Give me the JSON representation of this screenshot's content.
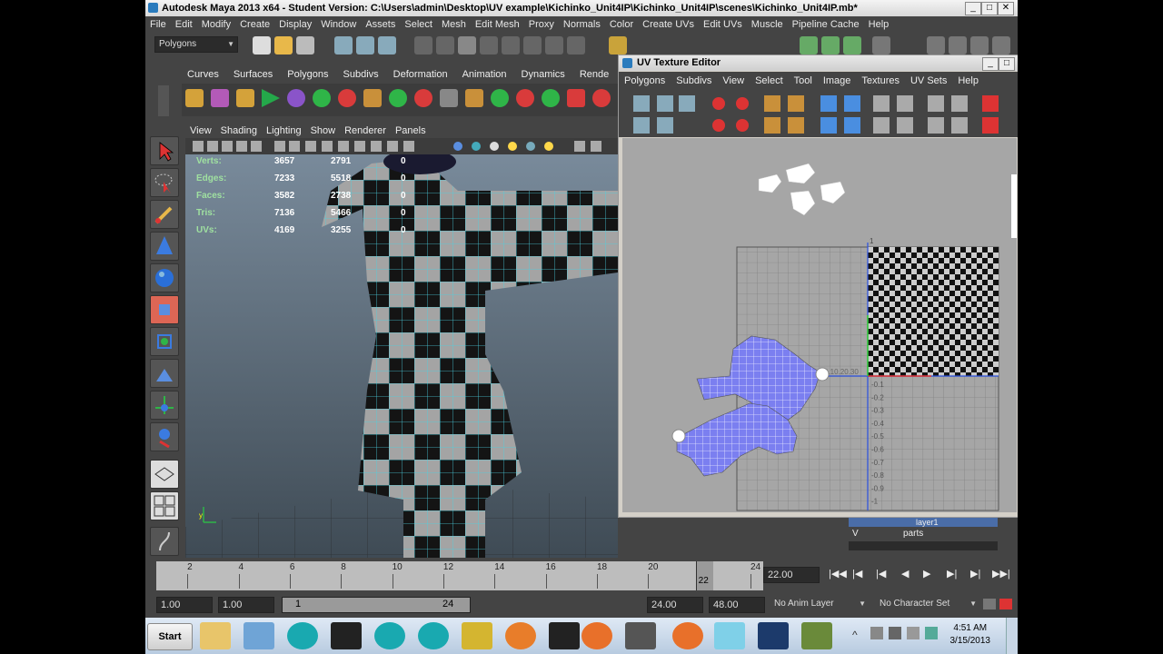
{
  "window": {
    "title": "Autodesk Maya 2013 x64 - Student Version: C:\\Users\\admin\\Desktop\\UV example\\Kichinko_Unit4IP\\Kichinko_Unit4IP\\scenes\\Kichinko_Unit4IP.mb*"
  },
  "menubar": [
    "File",
    "Edit",
    "Modify",
    "Create",
    "Display",
    "Window",
    "Assets",
    "Select",
    "Mesh",
    "Edit Mesh",
    "Proxy",
    "Normals",
    "Color",
    "Create UVs",
    "Edit UVs",
    "Muscle",
    "Pipeline Cache",
    "Help"
  ],
  "statusline": {
    "menuset": "Polygons"
  },
  "shelf": {
    "tabs": [
      "Curves",
      "Surfaces",
      "Polygons",
      "Subdivs",
      "Deformation",
      "Animation",
      "Dynamics",
      "Rende"
    ]
  },
  "viewport": {
    "menu": [
      "View",
      "Shading",
      "Lighting",
      "Show",
      "Renderer",
      "Panels"
    ],
    "hud": [
      {
        "label": "Verts:",
        "a": "3657",
        "b": "2791",
        "c": "0"
      },
      {
        "label": "Edges:",
        "a": "7233",
        "b": "5518",
        "c": "0"
      },
      {
        "label": "Faces:",
        "a": "3582",
        "b": "2738",
        "c": "0"
      },
      {
        "label": "Tris:",
        "a": "7136",
        "b": "5466",
        "c": "0"
      },
      {
        "label": "UVs:",
        "a": "4169",
        "b": "3255",
        "c": "0"
      }
    ]
  },
  "uv_editor": {
    "title": "UV Texture Editor",
    "menu": [
      "Polygons",
      "Subdivs",
      "View",
      "Select",
      "Tool",
      "Image",
      "Textures",
      "UV Sets",
      "Help"
    ],
    "axis_labels_neg": [
      "-0.1",
      "-0.2",
      "-0.3",
      "-0.4",
      "-0.5",
      "-0.6",
      "-0.7",
      "-0.8",
      "-0.9",
      "-1"
    ],
    "axis_top": "1",
    "axis_origin": "0.10.20.30"
  },
  "layers": {
    "layer1": "layer1",
    "parts": "parts",
    "v_label": "V"
  },
  "timeslider": {
    "ticks": [
      "2",
      "4",
      "6",
      "8",
      "10",
      "12",
      "14",
      "16",
      "18",
      "20",
      "22",
      "24"
    ],
    "current_marker": "22",
    "current_time": "22.00"
  },
  "range": {
    "start": "1.00",
    "start2": "1.00",
    "range_start": "1",
    "range_end": "24",
    "end1": "24.00",
    "end2": "48.00",
    "anim_layer": "No Anim Layer",
    "char_set": "No Character Set"
  },
  "taskbar": {
    "start": "Start",
    "time": "4:51 AM",
    "date": "3/15/2013"
  },
  "colors": {
    "maya_bg": "#444444",
    "uv_fill": "#7b7ff0",
    "hud_label": "#9fe0a0"
  }
}
